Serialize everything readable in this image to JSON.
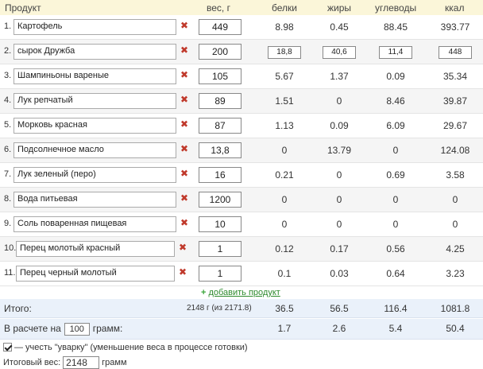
{
  "header": {
    "product": "Продукт",
    "weight": "вес, г",
    "protein": "белки",
    "fat": "жиры",
    "carbs": "углеводы",
    "kcal": "ккал"
  },
  "rows": [
    {
      "num": "1.",
      "name": "Картофель",
      "weight": "449",
      "protein": "8.98",
      "fat": "0.45",
      "carbs": "88.45",
      "kcal": "393.77"
    },
    {
      "num": "2.",
      "name": "сырок Дружба",
      "weight": "200",
      "protein": "18,8",
      "fat": "40,6",
      "carbs": "11,4",
      "kcal": "448"
    },
    {
      "num": "3.",
      "name": "Шампиньоны вареные",
      "weight": "105",
      "protein": "5.67",
      "fat": "1.37",
      "carbs": "0.09",
      "kcal": "35.34"
    },
    {
      "num": "4.",
      "name": "Лук репчатый",
      "weight": "89",
      "protein": "1.51",
      "fat": "0",
      "carbs": "8.46",
      "kcal": "39.87"
    },
    {
      "num": "5.",
      "name": "Морковь красная",
      "weight": "87",
      "protein": "1.13",
      "fat": "0.09",
      "carbs": "6.09",
      "kcal": "29.67"
    },
    {
      "num": "6.",
      "name": "Подсолнечное масло",
      "weight": "13,8",
      "protein": "0",
      "fat": "13.79",
      "carbs": "0",
      "kcal": "124.08"
    },
    {
      "num": "7.",
      "name": "Лук зеленый (перо)",
      "weight": "16",
      "protein": "0.21",
      "fat": "0",
      "carbs": "0.69",
      "kcal": "3.58"
    },
    {
      "num": "8.",
      "name": "Вода питьевая",
      "weight": "1200",
      "protein": "0",
      "fat": "0",
      "carbs": "0",
      "kcal": "0"
    },
    {
      "num": "9.",
      "name": "Соль поваренная пищевая",
      "weight": "10",
      "protein": "0",
      "fat": "0",
      "carbs": "0",
      "kcal": "0"
    },
    {
      "num": "10.",
      "name": "Перец молотый красный",
      "weight": "1",
      "protein": "0.12",
      "fat": "0.17",
      "carbs": "0.56",
      "kcal": "4.25"
    },
    {
      "num": "11.",
      "name": "Перец черный молотый",
      "weight": "1",
      "protein": "0.1",
      "fat": "0.03",
      "carbs": "0.64",
      "kcal": "3.23"
    }
  ],
  "add_product": "добавить продукт",
  "totals": {
    "label": "Итого:",
    "weight_text": "2148 г (из 2171.8)",
    "protein": "36.5",
    "fat": "56.5",
    "carbs": "116.4",
    "kcal": "1081.8"
  },
  "per": {
    "label_before": "В расчете на",
    "amount": "100",
    "label_after": "грамм:",
    "protein": "1.7",
    "fat": "2.6",
    "carbs": "5.4",
    "kcal": "50.4"
  },
  "option_text": "— учесть \"уварку\" (уменьшение веса в процессе готовки)",
  "final_weight": {
    "label": "Итоговый вес:",
    "value": "2148",
    "unit": "грамм"
  }
}
